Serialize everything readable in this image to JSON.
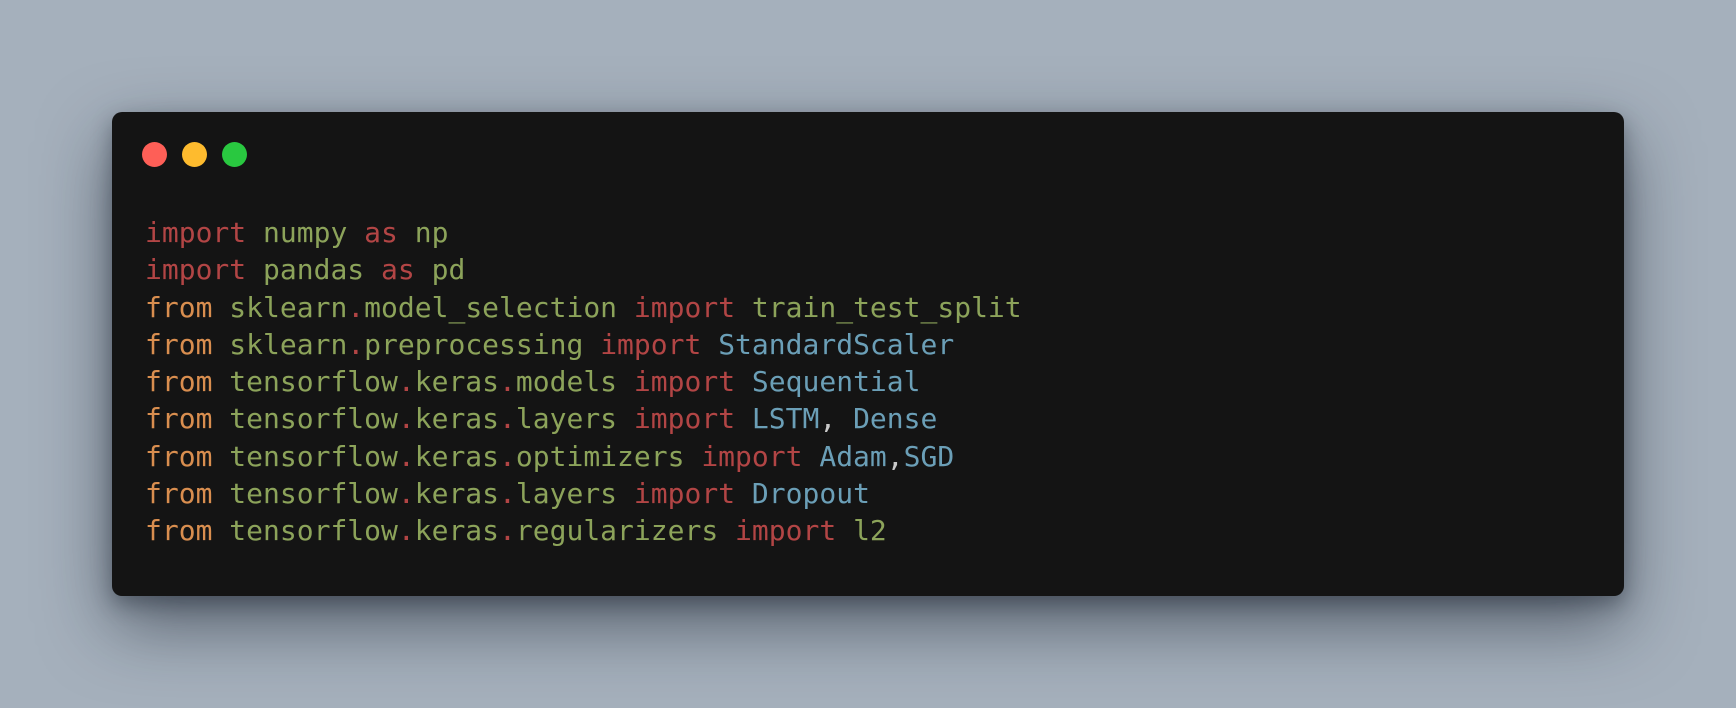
{
  "window": {
    "controls": [
      {
        "name": "close-button",
        "color": "#fe5f57"
      },
      {
        "name": "minimize-button",
        "color": "#febb2e"
      },
      {
        "name": "maximize-button",
        "color": "#29c840"
      }
    ]
  },
  "code": {
    "lines": [
      [
        {
          "t": "import",
          "k": "keyword"
        },
        {
          "t": " ",
          "k": "plain"
        },
        {
          "t": "numpy",
          "k": "module"
        },
        {
          "t": " ",
          "k": "plain"
        },
        {
          "t": "as",
          "k": "keyword"
        },
        {
          "t": " ",
          "k": "plain"
        },
        {
          "t": "np",
          "k": "module"
        }
      ],
      [
        {
          "t": "import",
          "k": "keyword"
        },
        {
          "t": " ",
          "k": "plain"
        },
        {
          "t": "pandas",
          "k": "module"
        },
        {
          "t": " ",
          "k": "plain"
        },
        {
          "t": "as",
          "k": "keyword"
        },
        {
          "t": " ",
          "k": "plain"
        },
        {
          "t": "pd",
          "k": "module"
        }
      ],
      [
        {
          "t": "from",
          "k": "from"
        },
        {
          "t": " ",
          "k": "plain"
        },
        {
          "t": "sklearn",
          "k": "module"
        },
        {
          "t": ".",
          "k": "dot"
        },
        {
          "t": "model_selection",
          "k": "module"
        },
        {
          "t": " ",
          "k": "plain"
        },
        {
          "t": "import",
          "k": "keyword"
        },
        {
          "t": " ",
          "k": "plain"
        },
        {
          "t": "train_test_split",
          "k": "module"
        }
      ],
      [
        {
          "t": "from",
          "k": "from"
        },
        {
          "t": " ",
          "k": "plain"
        },
        {
          "t": "sklearn",
          "k": "module"
        },
        {
          "t": ".",
          "k": "dot"
        },
        {
          "t": "preprocessing",
          "k": "module"
        },
        {
          "t": " ",
          "k": "plain"
        },
        {
          "t": "import",
          "k": "keyword"
        },
        {
          "t": " ",
          "k": "plain"
        },
        {
          "t": "StandardScaler",
          "k": "class"
        }
      ],
      [
        {
          "t": "from",
          "k": "from"
        },
        {
          "t": " ",
          "k": "plain"
        },
        {
          "t": "tensorflow",
          "k": "module"
        },
        {
          "t": ".",
          "k": "dot"
        },
        {
          "t": "keras",
          "k": "module"
        },
        {
          "t": ".",
          "k": "dot"
        },
        {
          "t": "models",
          "k": "module"
        },
        {
          "t": " ",
          "k": "plain"
        },
        {
          "t": "import",
          "k": "keyword"
        },
        {
          "t": " ",
          "k": "plain"
        },
        {
          "t": "Sequential",
          "k": "class"
        }
      ],
      [
        {
          "t": "from",
          "k": "from"
        },
        {
          "t": " ",
          "k": "plain"
        },
        {
          "t": "tensorflow",
          "k": "module"
        },
        {
          "t": ".",
          "k": "dot"
        },
        {
          "t": "keras",
          "k": "module"
        },
        {
          "t": ".",
          "k": "dot"
        },
        {
          "t": "layers",
          "k": "module"
        },
        {
          "t": " ",
          "k": "plain"
        },
        {
          "t": "import",
          "k": "keyword"
        },
        {
          "t": " ",
          "k": "plain"
        },
        {
          "t": "LSTM",
          "k": "class"
        },
        {
          "t": ", ",
          "k": "plain"
        },
        {
          "t": "Dense",
          "k": "class"
        }
      ],
      [
        {
          "t": "from",
          "k": "from"
        },
        {
          "t": " ",
          "k": "plain"
        },
        {
          "t": "tensorflow",
          "k": "module"
        },
        {
          "t": ".",
          "k": "dot"
        },
        {
          "t": "keras",
          "k": "module"
        },
        {
          "t": ".",
          "k": "dot"
        },
        {
          "t": "optimizers",
          "k": "module"
        },
        {
          "t": " ",
          "k": "plain"
        },
        {
          "t": "import",
          "k": "keyword"
        },
        {
          "t": " ",
          "k": "plain"
        },
        {
          "t": "Adam",
          "k": "class"
        },
        {
          "t": ",",
          "k": "plain"
        },
        {
          "t": "SGD",
          "k": "class"
        }
      ],
      [
        {
          "t": "from",
          "k": "from"
        },
        {
          "t": " ",
          "k": "plain"
        },
        {
          "t": "tensorflow",
          "k": "module"
        },
        {
          "t": ".",
          "k": "dot"
        },
        {
          "t": "keras",
          "k": "module"
        },
        {
          "t": ".",
          "k": "dot"
        },
        {
          "t": "layers",
          "k": "module"
        },
        {
          "t": " ",
          "k": "plain"
        },
        {
          "t": "import",
          "k": "keyword"
        },
        {
          "t": " ",
          "k": "plain"
        },
        {
          "t": "Dropout",
          "k": "class"
        }
      ],
      [
        {
          "t": "from",
          "k": "from"
        },
        {
          "t": " ",
          "k": "plain"
        },
        {
          "t": "tensorflow",
          "k": "module"
        },
        {
          "t": ".",
          "k": "dot"
        },
        {
          "t": "keras",
          "k": "module"
        },
        {
          "t": ".",
          "k": "dot"
        },
        {
          "t": "regularizers",
          "k": "module"
        },
        {
          "t": " ",
          "k": "plain"
        },
        {
          "t": "import",
          "k": "keyword"
        },
        {
          "t": " ",
          "k": "plain"
        },
        {
          "t": "l2",
          "k": "module"
        }
      ]
    ]
  }
}
